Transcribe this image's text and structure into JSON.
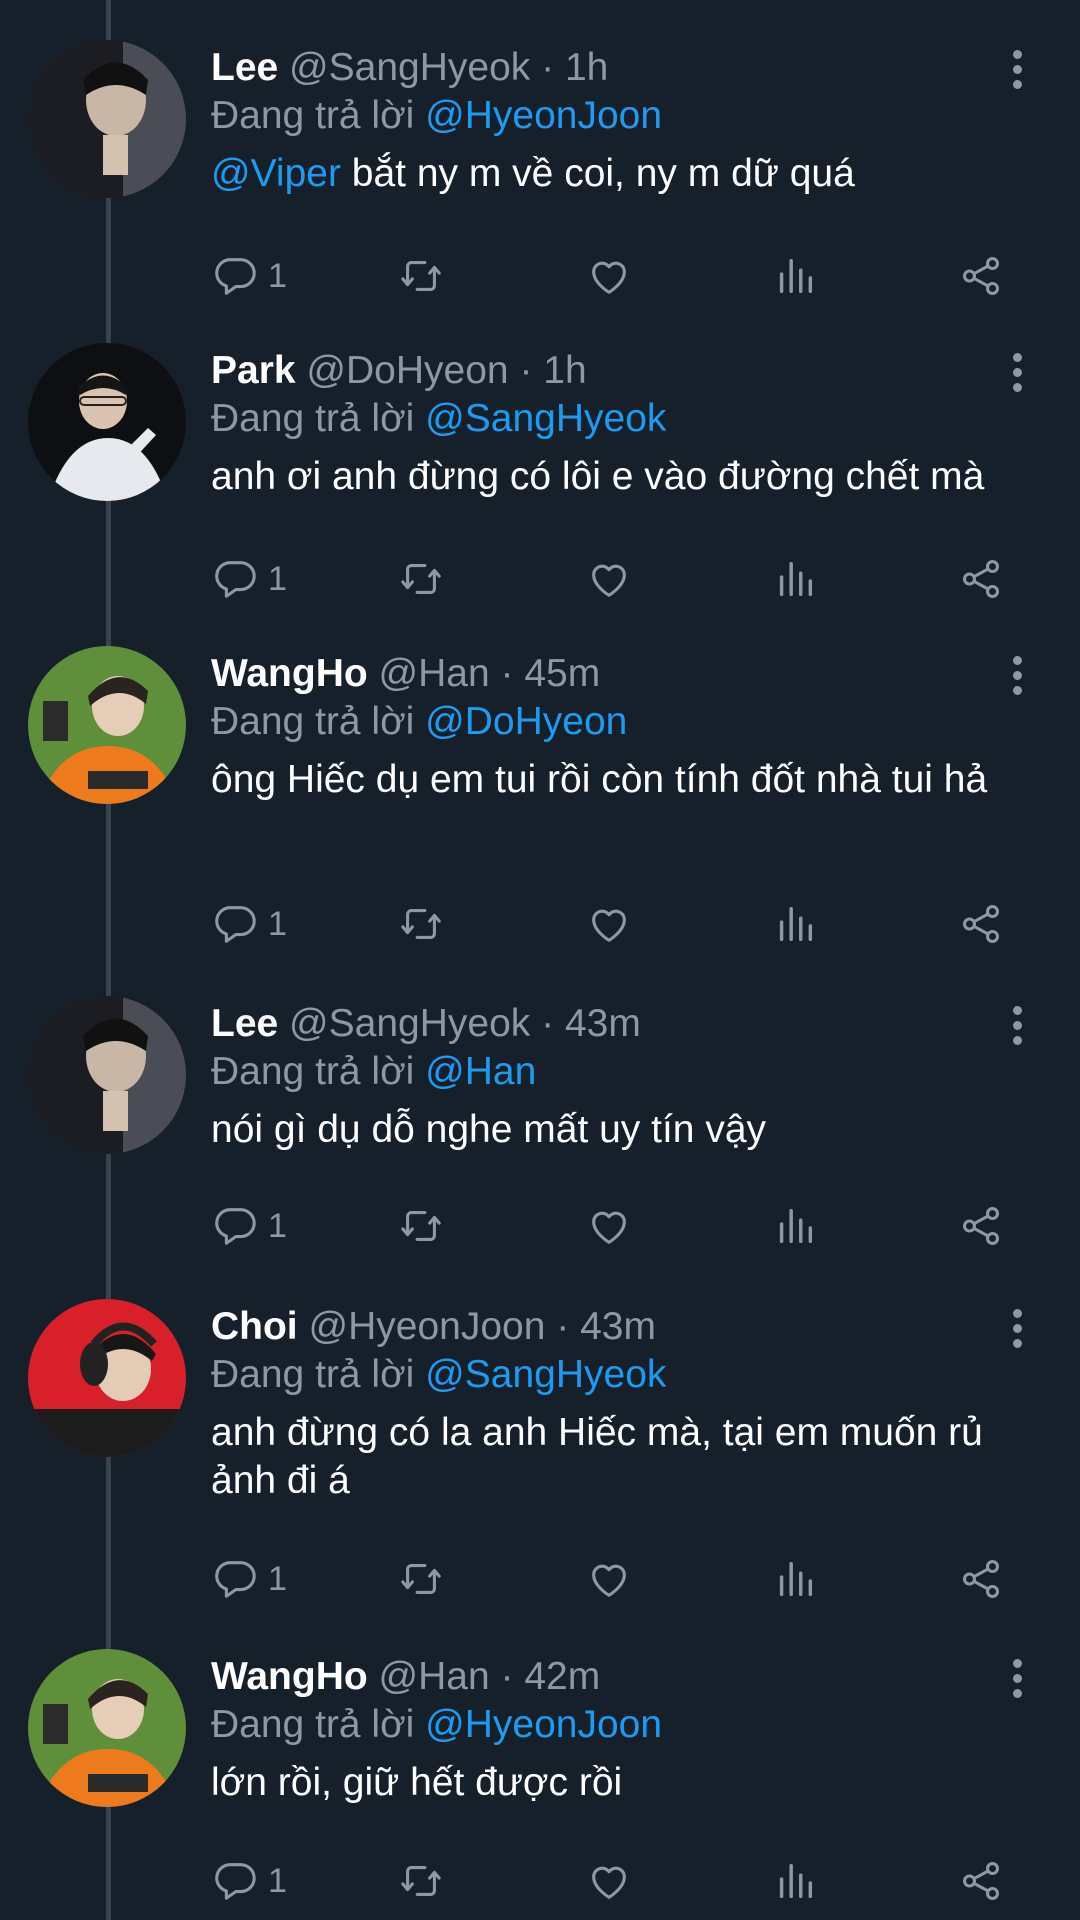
{
  "reply_prefix": "Đang trả lời",
  "tweets": [
    {
      "name": "Lee",
      "handle": "@SangHyeok",
      "time": "1h",
      "reply_to": "@HyeonJoon",
      "body_mention": "@Viper",
      "body": " bắt ny m về coi, ny m dữ quá",
      "reply_count": "1"
    },
    {
      "name": "Park",
      "handle": "@DoHyeon",
      "time": "1h",
      "reply_to": "@SangHyeok",
      "body_mention": "",
      "body": "anh ơi anh đừng có lôi e vào đường chết mà",
      "reply_count": "1"
    },
    {
      "name": "WangHo",
      "handle": "@Han",
      "time": "45m",
      "reply_to": "@DoHyeon",
      "body_mention": "",
      "body": "ông Hiếc dụ em tui rồi còn tính đốt nhà tui hả",
      "reply_count": "1"
    },
    {
      "name": "Lee",
      "handle": "@SangHyeok",
      "time": "43m",
      "reply_to": "@Han",
      "body_mention": "",
      "body": "nói gì dụ dỗ nghe mất uy tín vậy",
      "reply_count": "1"
    },
    {
      "name": "Choi",
      "handle": "@HyeonJoon",
      "time": "43m",
      "reply_to": "@SangHyeok",
      "body_mention": "",
      "body": "anh đừng có la anh Hiếc mà, tại em muốn rủ ảnh đi á",
      "reply_count": "1"
    },
    {
      "name": "WangHo",
      "handle": "@Han",
      "time": "42m",
      "reply_to": "@HyeonJoon",
      "body_mention": "",
      "body": "lớn rồi, giữ hết được rồi",
      "reply_count": "1"
    }
  ],
  "colors": {
    "background": "#15202b",
    "mention": "#1d9bf0",
    "muted": "#8b98a5",
    "thread_line": "#38444d"
  },
  "icons": [
    "reply-icon",
    "retweet-icon",
    "like-icon",
    "views-icon",
    "share-icon",
    "more-icon"
  ]
}
